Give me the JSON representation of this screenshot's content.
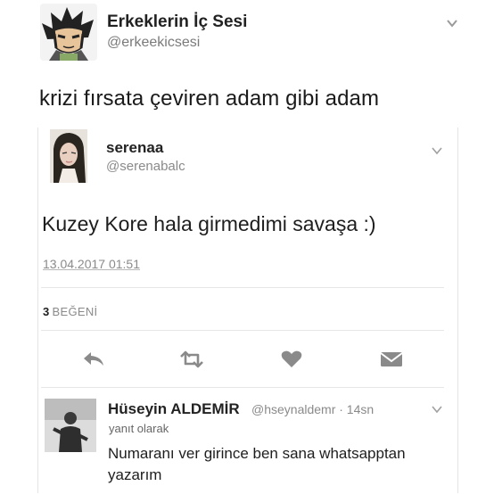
{
  "outer_tweet": {
    "display_name": "Erkeklerin İç Sesi",
    "handle": "@erkeekicsesi",
    "text": "krizi fırsata çeviren adam gibi adam",
    "menu_icon": "chevron-down-icon"
  },
  "quoted_tweet": {
    "display_name": "serenaa",
    "handle": "@serenabalc",
    "text": "Kuzey Kore hala girmedimi savaşa :)",
    "date": "13.04.2017 01:51",
    "likes_count": "3",
    "likes_label": "BEĞENİ",
    "actions": [
      "reply-icon",
      "retweet-icon",
      "like-icon",
      "message-icon"
    ]
  },
  "reply": {
    "display_name": "Hüseyin ALDEMİR",
    "meta": "@hseynaldemr · 14sn",
    "context": "yanıt olarak",
    "text": "Numaranı ver girince ben sana whatsapptan yazarım"
  },
  "colors": {
    "text": "#1e1e1e",
    "secondary": "#8a8a8a",
    "icon": "#8a8a8a",
    "divider": "#e6e6e6"
  }
}
